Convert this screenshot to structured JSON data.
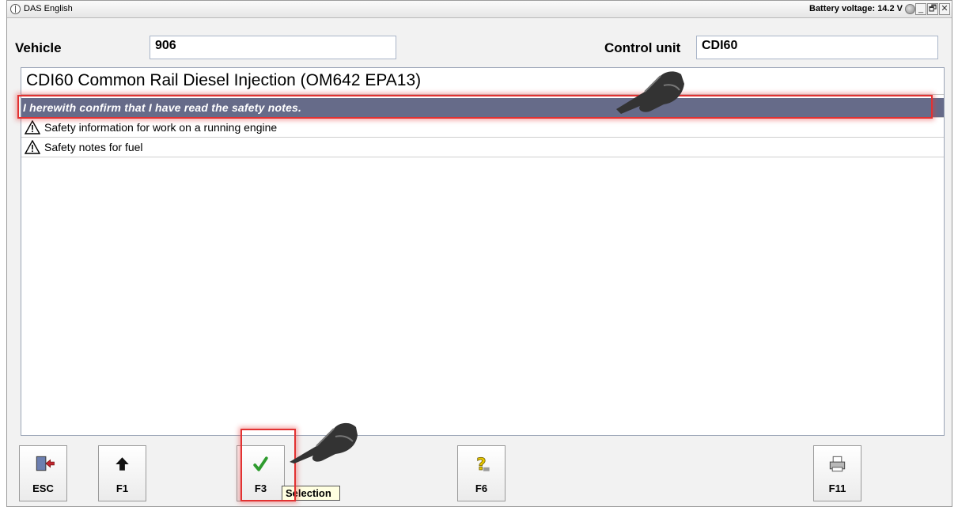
{
  "window": {
    "title": "DAS English",
    "battery_voltage": "Battery voltage: 14.2 V",
    "controls": {
      "minimize": "_",
      "restore": "🗗",
      "close": "✕"
    }
  },
  "header": {
    "vehicle_label": "Vehicle",
    "vehicle_value": "906",
    "control_unit_label": "Control unit",
    "control_unit_value": "CDI60"
  },
  "content": {
    "heading": "CDI60  Common Rail Diesel Injection (OM642 EPA13)",
    "rows": [
      {
        "text": "I herewith confirm that I have read the safety notes.",
        "selected": true
      },
      {
        "text": "Safety information for work on a running engine",
        "icon": "warning-icon"
      },
      {
        "text": "Safety notes for fuel",
        "icon": "warning-icon"
      }
    ]
  },
  "function_keys": [
    {
      "label": "ESC",
      "icon": "exit-door-icon"
    },
    {
      "label": "F1",
      "icon": "arrow-up-icon"
    },
    {
      "label": "F3",
      "icon": "checkmark-icon"
    },
    {
      "label": "F6",
      "icon": "help-icon"
    },
    {
      "label": "F11",
      "icon": "printer-icon"
    }
  ],
  "tooltip": "Selection",
  "colors": {
    "selected_row": "#666b89",
    "highlight": "#e23232",
    "check": "#2e9b2e"
  }
}
